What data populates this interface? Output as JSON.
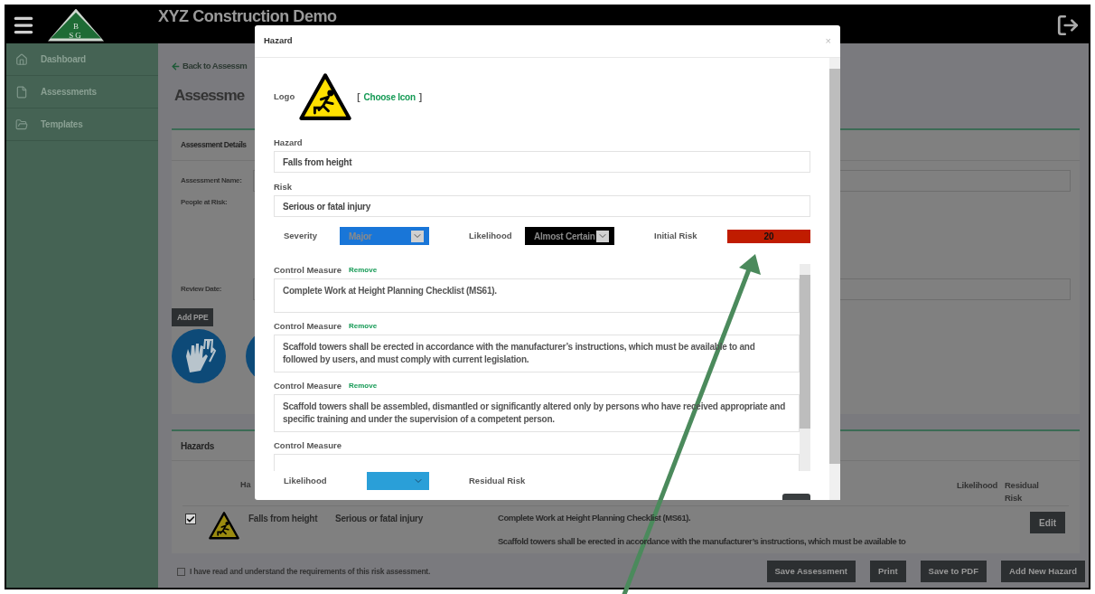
{
  "app": {
    "title": "XYZ Construction Demo",
    "logo": [
      "B",
      "SG"
    ]
  },
  "sidebar": {
    "items": [
      {
        "label": "Dashboard"
      },
      {
        "label": "Assessments"
      },
      {
        "label": "Templates"
      }
    ]
  },
  "page": {
    "back_link": "Back to Assessm",
    "heading": "Assessme"
  },
  "details": {
    "title": "Assessment Details",
    "fields": [
      {
        "label": "Assessment Name:",
        "kind": "input"
      },
      {
        "label": "People at Risk:",
        "kind": "area"
      },
      {
        "label": "Review Date:",
        "kind": "input"
      }
    ],
    "add_ppe": "Add PPE"
  },
  "hazards": {
    "title": "Hazards",
    "columns": [
      "Ha",
      "Likelihood",
      "Residual Risk"
    ],
    "rows": [
      {
        "checked": true,
        "hazard": "Falls from height",
        "risk": "Serious or fatal injury",
        "controls": [
          "Complete Work at Height Planning Checklist (MS61).",
          "Scaffold towers shall be erected in accordance with the manufacturer’s instructions, which must be available to"
        ],
        "action": "Edit"
      }
    ]
  },
  "footer": {
    "acknowledge": {
      "label": "I have read and understand the requirements of this risk assessment.",
      "checked": false
    },
    "buttons": [
      "Save Assessment",
      "Print",
      "Save to PDF",
      "Add New Hazard"
    ]
  },
  "modal": {
    "title": "Hazard",
    "close": "×",
    "logo_label": "Logo",
    "choose_icon": {
      "open": "[",
      "link": "Choose Icon",
      "close": "]"
    },
    "fields": [
      {
        "label": "Hazard",
        "value": "Falls from height"
      },
      {
        "label": "Risk",
        "value": "Serious or fatal injury"
      }
    ],
    "ratings": [
      {
        "kind": "select",
        "label": "Severity",
        "value": "Major",
        "color": "#1976d8"
      },
      {
        "kind": "select",
        "label": "Likelihood",
        "value": "Almost Certain",
        "color": "#000000"
      },
      {
        "kind": "score",
        "label": "Initial Risk",
        "value": "20",
        "color": "#c01c00"
      }
    ],
    "controls": [
      {
        "label": "Control Measure",
        "remove": "Remove",
        "text": "Complete Work at Height Planning Checklist (MS61)."
      },
      {
        "label": "Control Measure",
        "remove": "Remove",
        "text": "Scaffold towers shall be erected in accordance with the manufacturer’s instructions, which must be available to and followed by users, and must comply with current legislation."
      },
      {
        "label": "Control Measure",
        "remove": "Remove",
        "text": "Scaffold towers shall be assembled, dismantled or significantly altered only by persons who have received appropriate and specific training and under the supervision of a competent person."
      },
      {
        "label": "Control Measure"
      }
    ],
    "residual": [
      {
        "kind": "select",
        "label": "Likelihood",
        "color": "#2a9fd8"
      },
      {
        "kind": "label",
        "label": "Residual Risk"
      }
    ]
  }
}
